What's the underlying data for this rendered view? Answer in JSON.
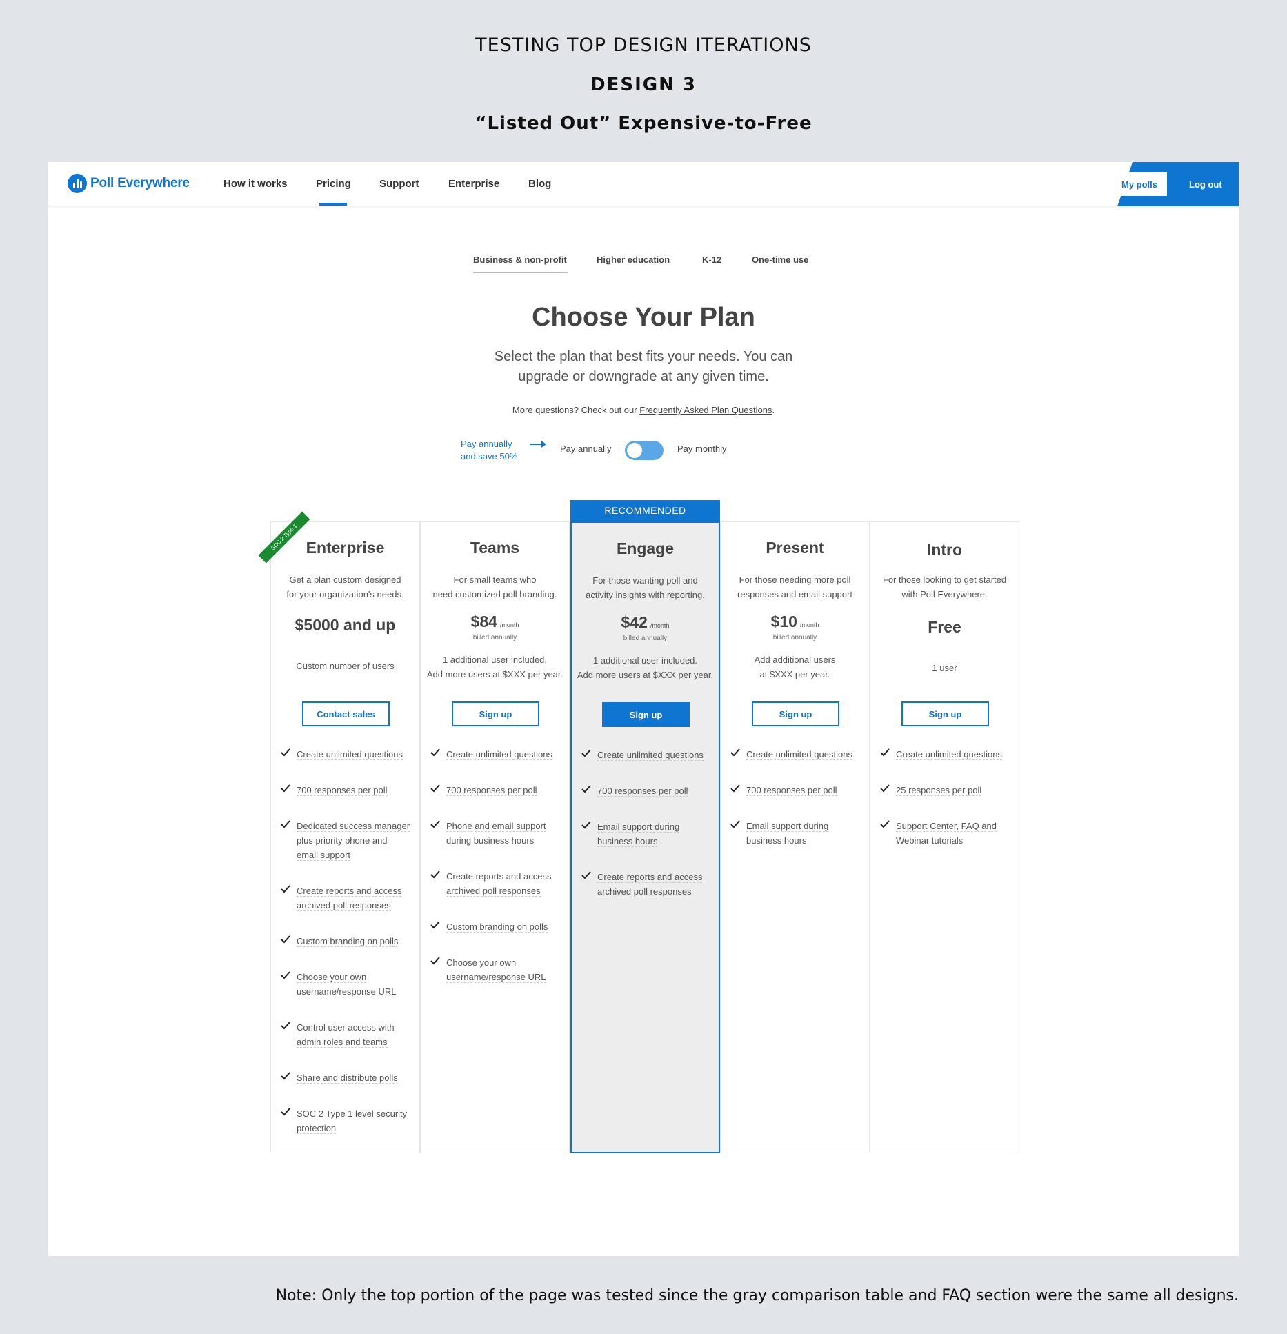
{
  "header": {
    "line1": "TESTING TOP DESIGN ITERATIONS",
    "line2": "DESIGN 3",
    "line3": "“Listed Out” Expensive-to-Free"
  },
  "nav": {
    "brand": "Poll Everywhere",
    "links": [
      "How it works",
      "Pricing",
      "Support",
      "Enterprise",
      "Blog"
    ],
    "active": "Pricing",
    "my_polls": "My polls",
    "log_out": "Log out"
  },
  "segments": [
    "Business & non-profit",
    "Higher education",
    "K-12",
    "One-time use"
  ],
  "page": {
    "title": "Choose Your Plan",
    "subtitle_1": "Select the plan that best fits your needs. You can",
    "subtitle_2": "upgrade or downgrade at any given time.",
    "faq_prefix": "More questions? Check out our ",
    "faq_link": "Frequently Asked Plan Questions",
    "faq_suffix": "."
  },
  "billing": {
    "save_1": "Pay annually",
    "save_2": "and save 50%",
    "annual": "Pay annually",
    "monthly": "Pay monthly"
  },
  "recommended_label": "RECOMMENDED",
  "plans": [
    {
      "name": "Enterprise",
      "badge": "SOC 2 Type 1",
      "desc_1": "Get a plan custom designed",
      "desc_2": "for your organization's needs.",
      "price": "$5000 and up",
      "users_1": "Custom number of users",
      "users_2": "",
      "button": "Contact sales",
      "features": [
        [
          "Create unlimited questions"
        ],
        [
          "700 responses per poll"
        ],
        [
          "Dedicated success manager",
          "plus priority phone and",
          "email support"
        ],
        [
          "Create reports and access",
          "archived poll responses"
        ],
        [
          "Custom branding on polls"
        ],
        [
          "Choose your own",
          "username/response URL"
        ],
        [
          "Control user access with",
          "admin roles and teams"
        ],
        [
          "Share and distribute polls"
        ],
        [
          "SOC 2 Type 1 level security",
          "protection"
        ]
      ]
    },
    {
      "name": "Teams",
      "desc_1": "For small teams who",
      "desc_2": "need customized poll branding.",
      "price": "$84",
      "per": "/month",
      "billed": "billed annually",
      "users_1": "1 additional user included.",
      "users_2": "Add more users at $XXX per year.",
      "button": "Sign up",
      "features": [
        [
          "Create unlimited questions"
        ],
        [
          "700 responses per poll"
        ],
        [
          "Phone and email support",
          "during business hours"
        ],
        [
          "Create reports and access",
          "archived poll responses"
        ],
        [
          "Custom branding on polls"
        ],
        [
          "Choose your own",
          "username/response URL"
        ]
      ]
    },
    {
      "name": "Engage",
      "desc_1": "For those wanting poll and",
      "desc_2": "activity insights with reporting.",
      "price": "$42",
      "per": "/month",
      "billed": "billed annually",
      "users_1": "1 additional user included.",
      "users_2": "Add more users at $XXX per year.",
      "button": "Sign up",
      "features": [
        [
          "Create unlimited questions"
        ],
        [
          "700 responses per poll"
        ],
        [
          "Email support during",
          "business hours"
        ],
        [
          "Create reports and access",
          "archived poll responses"
        ]
      ]
    },
    {
      "name": "Present",
      "desc_1": "For those needing more poll",
      "desc_2": "responses and email support",
      "price": "$10",
      "per": "/month",
      "billed": "billed annually",
      "users_1": "Add additional users",
      "users_2": "at $XXX per year.",
      "button": "Sign up",
      "features": [
        [
          "Create unlimited questions"
        ],
        [
          "700 responses per poll"
        ],
        [
          "Email support during",
          "business hours"
        ]
      ]
    },
    {
      "name": "Intro",
      "desc_1": "For those looking to get started",
      "desc_2": "with Poll Everywhere.",
      "price": "Free",
      "users_1": "1 user",
      "users_2": "",
      "button": "Sign up",
      "features": [
        [
          "Create unlimited questions"
        ],
        [
          "25 responses per poll"
        ],
        [
          "Support Center, FAQ and",
          "Webinar tutorials"
        ]
      ]
    }
  ],
  "note": "Note: Only the top portion of the page was tested since the gray comparison table and FAQ section were the same all designs.",
  "colors": {
    "accent": "#0e76d1",
    "badge": "#1a8a2e",
    "background": "#e1e4e8"
  }
}
